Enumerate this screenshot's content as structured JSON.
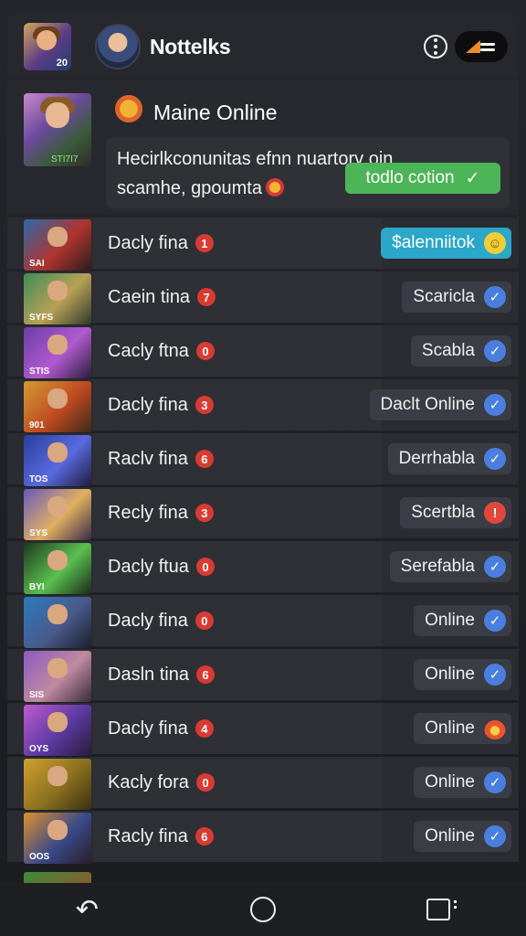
{
  "header": {
    "avatar_level": "20",
    "app_title": "Nottelks",
    "more_icon": "more-circle-icon",
    "menu_icon": "menu-icon"
  },
  "featured": {
    "thumb_level": "STI7I7",
    "title": "Maine Online",
    "message": "Hecirlkconunitas efnn nuartorv oin scamhe, gpoumta",
    "action_label": "todlo cotion",
    "action_icon": "check-icon",
    "action_color": "#4cb557"
  },
  "rows": [
    {
      "name": "Dacly fina",
      "badge": "1",
      "status": "$alenniitok",
      "status_icon": "emoji-icon",
      "level": "SAI",
      "variant": "cyan"
    },
    {
      "name": "Caein tina",
      "badge": "7",
      "status": "Scaricla",
      "status_icon": "check-icon",
      "level": "SYFS"
    },
    {
      "name": "Cacly ftna",
      "badge": "0",
      "status": "Scabla",
      "status_icon": "check-icon",
      "level": "STIS"
    },
    {
      "name": "Dacly fina",
      "badge": "3",
      "status": "Daclt Online",
      "status_icon": "check-icon",
      "level": "901"
    },
    {
      "name": "Raclv fina",
      "badge": "6",
      "status": "Derrhabla",
      "status_icon": "check-icon",
      "level": "TOS"
    },
    {
      "name": "Recly fina",
      "badge": "3",
      "status": "Scertbla",
      "status_icon": "alert-icon",
      "level": "SYS"
    },
    {
      "name": "Dacly ftua",
      "badge": "0",
      "status": "Serefabla",
      "status_icon": "check-icon",
      "level": "BYI"
    },
    {
      "name": "Dacly fina",
      "badge": "0",
      "status": "Online",
      "status_icon": "check-icon",
      "level": ""
    },
    {
      "name": "Dasln tina",
      "badge": "6",
      "status": "Online",
      "status_icon": "check-icon",
      "level": "SIS"
    },
    {
      "name": "Dacly fina",
      "badge": "4",
      "status": "Online",
      "status_icon": "fire-icon",
      "level": "OYS"
    },
    {
      "name": "Kacly fora",
      "badge": "0",
      "status": "Online",
      "status_icon": "check-icon",
      "level": ""
    },
    {
      "name": "Racly fina",
      "badge": "6",
      "status": "Online",
      "status_icon": "check-icon",
      "level": "OOS"
    }
  ],
  "nav": {
    "back_icon": "back-icon",
    "home_icon": "home-icon",
    "recent_icon": "recent-apps-icon"
  },
  "colors": {
    "background": "#1c1d21",
    "badge_red": "#d93a32",
    "check_blue": "#4a7fe0",
    "highlight_cyan": "#2aa7c9"
  }
}
